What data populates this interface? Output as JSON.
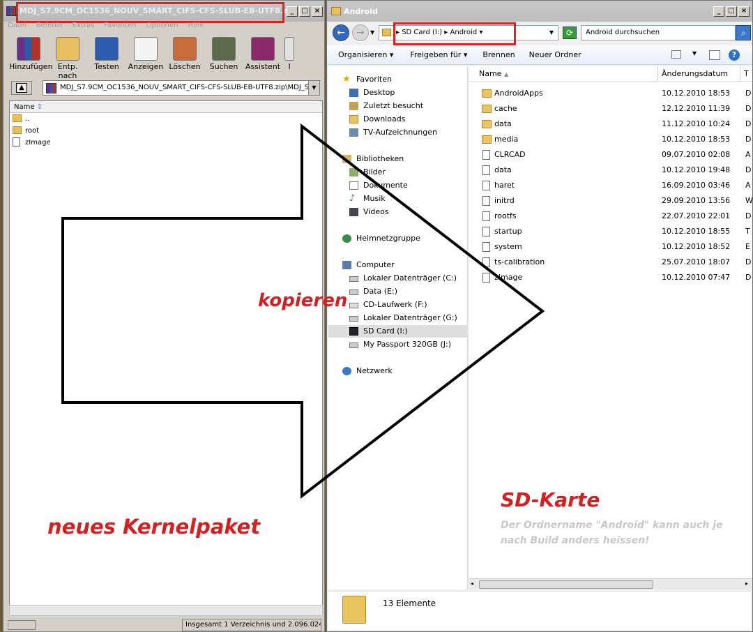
{
  "winrar": {
    "title": "MDJ_S7.9CM_OC1536_NOUV_SMART_CIFS-CFS-SLUB-EB-UTF8.zip",
    "menu": [
      "Datei",
      "Befehle",
      "Extras",
      "Favoriten",
      "Optionen",
      "Hilfe"
    ],
    "toolbar": [
      "Hinzufügen",
      "Entp. nach",
      "Testen",
      "Anzeigen",
      "Löschen",
      "Suchen",
      "Assistent",
      "I"
    ],
    "path": "MDJ_S7.9CM_OC1536_NOUV_SMART_CIFS-CFS-SLUB-EB-UTF8.zip\\MDJ_S",
    "column_name": "Name",
    "files": [
      "..",
      "root",
      "zImage"
    ],
    "status": "Insgesamt 1 Verzeichnis und 2.096.024"
  },
  "explorer": {
    "title": "Android",
    "breadcrumb": [
      "SD Card (I:)",
      "Android"
    ],
    "search_placeholder": "Android durchsuchen",
    "commands": [
      "Organisieren",
      "Freigeben für",
      "Brennen",
      "Neuer Ordner"
    ],
    "nav": {
      "favorites_header": "Favoriten",
      "favorites": [
        "Desktop",
        "Zuletzt besucht",
        "Downloads",
        "TV-Aufzeichnungen"
      ],
      "libraries_header": "Bibliotheken",
      "libraries": [
        "Bilder",
        "Dokumente",
        "Musik",
        "Videos"
      ],
      "homegroup": "Heimnetzgruppe",
      "computer_header": "Computer",
      "drives": [
        "Lokaler Datenträger (C:)",
        "Data (E:)",
        "CD-Laufwerk (F:)",
        "Lokaler Datenträger (G:)",
        "SD Card (I:)",
        "My Passport 320GB (J:)"
      ],
      "network": "Netzwerk"
    },
    "columns": [
      "Name",
      "Änderungsdatum",
      "T"
    ],
    "files": [
      {
        "name": "AndroidApps",
        "date": "10.12.2010 18:53",
        "type": "D",
        "kind": "folder"
      },
      {
        "name": "cache",
        "date": "12.12.2010 11:39",
        "type": "D",
        "kind": "folder"
      },
      {
        "name": "data",
        "date": "11.12.2010 10:24",
        "type": "D",
        "kind": "folder"
      },
      {
        "name": "media",
        "date": "10.12.2010 18:53",
        "type": "D",
        "kind": "folder"
      },
      {
        "name": "CLRCAD",
        "date": "09.07.2010 02:08",
        "type": "A",
        "kind": "file"
      },
      {
        "name": "data",
        "date": "10.12.2010 19:48",
        "type": "D",
        "kind": "file"
      },
      {
        "name": "haret",
        "date": "16.09.2010 03:46",
        "type": "A",
        "kind": "file"
      },
      {
        "name": "initrd",
        "date": "29.09.2010 13:56",
        "type": "W",
        "kind": "file"
      },
      {
        "name": "rootfs",
        "date": "22.07.2010 22:01",
        "type": "D",
        "kind": "file"
      },
      {
        "name": "startup",
        "date": "10.12.2010 18:55",
        "type": "T",
        "kind": "file"
      },
      {
        "name": "system",
        "date": "10.12.2010 18:52",
        "type": "E",
        "kind": "file"
      },
      {
        "name": "ts-calibration",
        "date": "25.07.2010 18:07",
        "type": "D",
        "kind": "file"
      },
      {
        "name": "zImage",
        "date": "10.12.2010 07:47",
        "type": "D",
        "kind": "file"
      }
    ],
    "item_count": "13 Elemente"
  },
  "annotations": {
    "copy": "kopieren",
    "new_kernel": "neues Kernelpaket",
    "sd_card": "SD-Karte",
    "note": "Der Ordnername \"Android\" kann auch je nach Build anders heissen!"
  },
  "colors": {
    "annotation_red": "#d42020",
    "highlight_box": "#e0211d",
    "note_gray": "#c8c8c8"
  }
}
